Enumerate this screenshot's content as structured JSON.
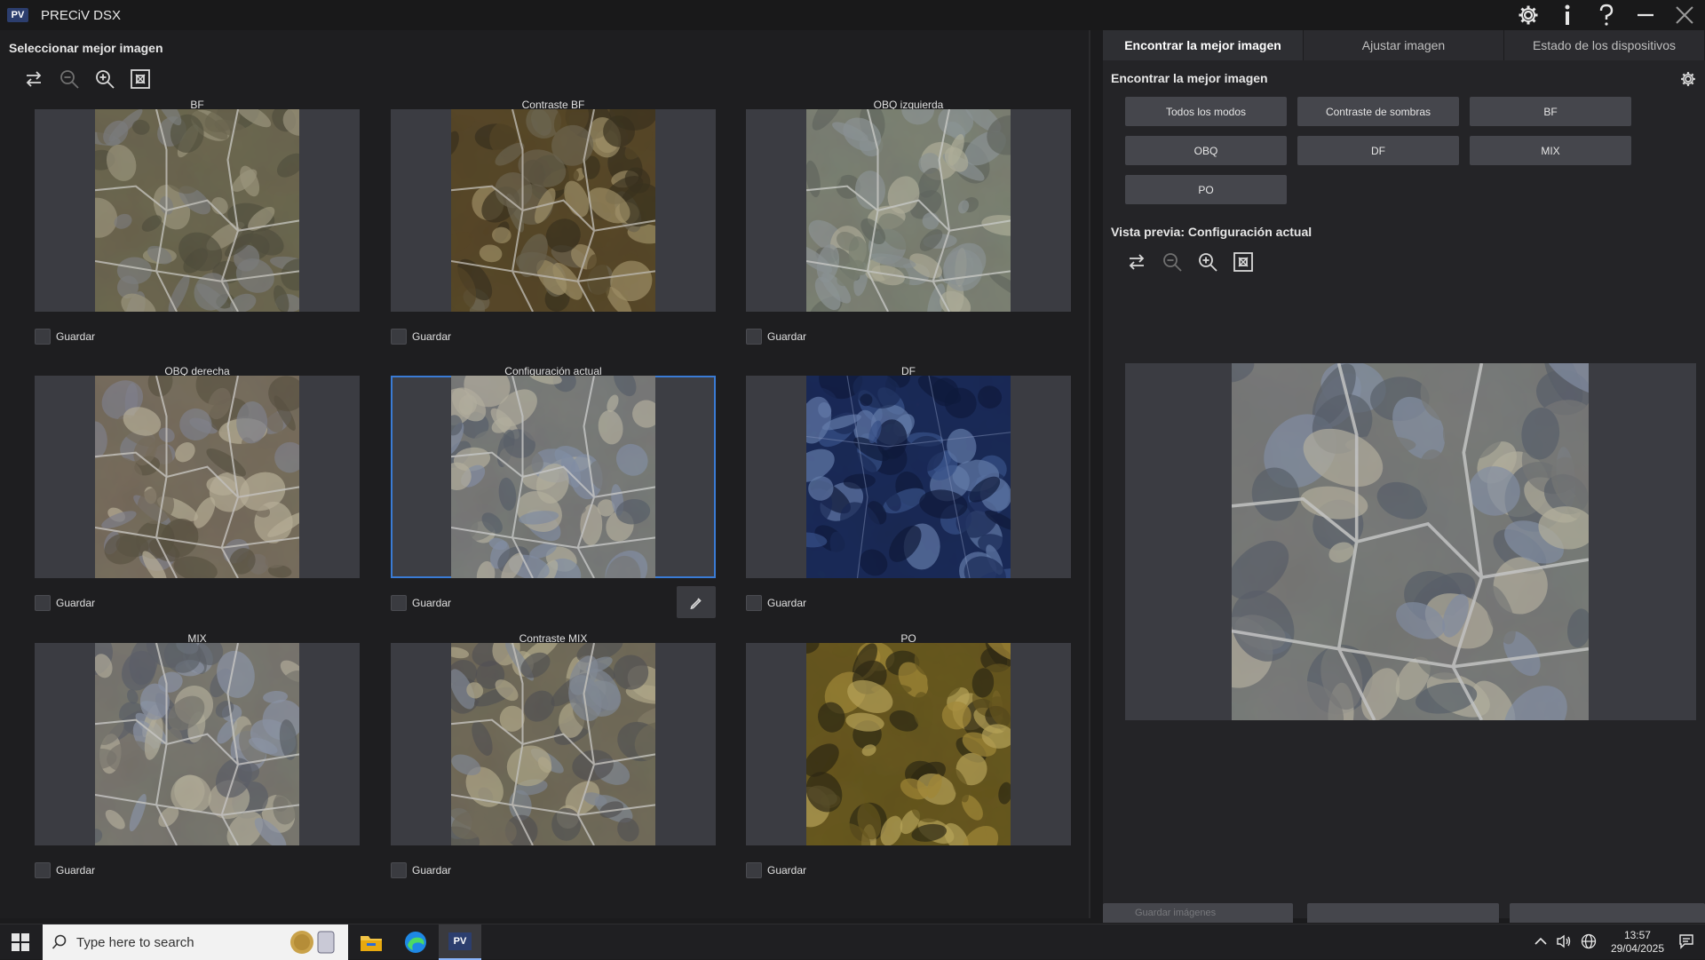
{
  "window": {
    "app_logo": "PV",
    "title": "PRECiV DSX"
  },
  "title_actions": [
    "gear-icon",
    "info-icon",
    "help-icon",
    "minimize-icon",
    "close-icon"
  ],
  "left": {
    "heading": "Seleccionar mejor imagen",
    "toolbar": [
      "swap-icon",
      "zoom-out-icon",
      "zoom-in-icon",
      "fit-icon"
    ],
    "grid": [
      {
        "label": "BF",
        "save": "Guardar",
        "tone": "bf"
      },
      {
        "label": "Contraste BF",
        "save": "Guardar",
        "tone": "contrast_bf"
      },
      {
        "label": "OBQ izquierda",
        "save": "Guardar",
        "tone": "obq_left"
      },
      {
        "label": "OBQ derecha",
        "save": "Guardar",
        "tone": "obq_right"
      },
      {
        "label": "Configuración actual",
        "save": "Guardar",
        "tone": "current",
        "selected": true
      },
      {
        "label": "DF",
        "save": "Guardar",
        "tone": "df"
      },
      {
        "label": "MIX",
        "save": "Guardar",
        "tone": "mix"
      },
      {
        "label": "Contraste MIX",
        "save": "Guardar",
        "tone": "contrast_mix"
      },
      {
        "label": "PO",
        "save": "Guardar",
        "tone": "po"
      }
    ]
  },
  "right": {
    "tabs": [
      "Encontrar la mejor imagen",
      "Ajustar imagen",
      "Estado de los dispositivos"
    ],
    "active_tab": 0,
    "heading": "Encontrar la mejor imagen",
    "modes": [
      "Todos los modos",
      "Contraste de sombras",
      "BF",
      "OBQ",
      "DF",
      "MIX",
      "PO"
    ],
    "preview_heading": "Vista previa: Configuración actual",
    "preview_toolbar": [
      "swap-icon",
      "zoom-out-icon",
      "zoom-in-icon",
      "fit-icon"
    ],
    "bottom_buttons": [
      "Guardar imágenes",
      "",
      ""
    ]
  },
  "taskbar": {
    "search_placeholder": "Type here to search",
    "pinned": [
      "file-explorer-icon",
      "edge-icon",
      "preciv-icon"
    ],
    "pv_label": "PV",
    "time": "13:57",
    "date": "29/04/2025"
  },
  "colors": {
    "selection": "#3a7bd5",
    "panel_bg": "#3b3c42",
    "button_bg": "#45464c"
  }
}
